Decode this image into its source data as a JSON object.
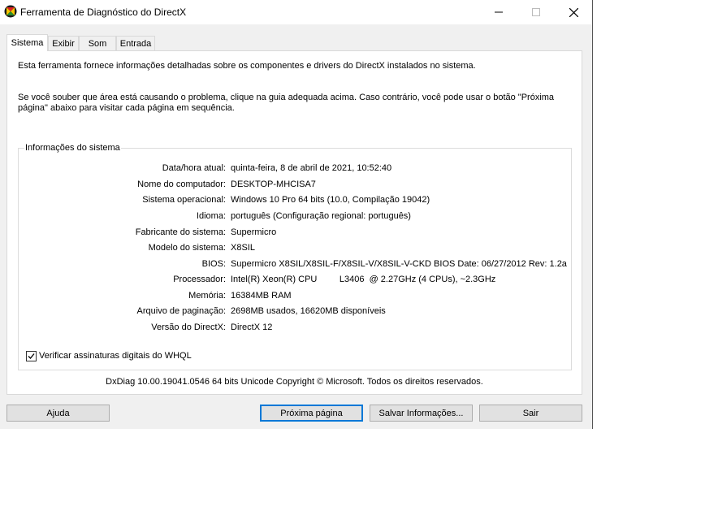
{
  "window": {
    "title": "Ferramenta de Diagnóstico do DirectX",
    "app_icon": "directx-icon"
  },
  "tabs": [
    {
      "label": "Sistema",
      "active": true
    },
    {
      "label": "Exibir",
      "active": false
    },
    {
      "label": "Som",
      "active": false
    },
    {
      "label": "Entrada",
      "active": false
    }
  ],
  "intro": {
    "line1": "Esta ferramenta fornece informações detalhadas sobre os componentes e drivers do DirectX instalados no sistema.",
    "line2": "Se você souber que área está causando o problema, clique na guia adequada acima. Caso contrário, você pode usar o botão \"Próxima página\" abaixo para visitar cada página em sequência."
  },
  "system_info": {
    "group_title": "Informações do sistema",
    "rows": [
      {
        "label": "Data/hora atual:",
        "value": "quinta-feira, 8 de abril de 2021, 10:52:40"
      },
      {
        "label": "Nome do computador:",
        "value": "DESKTOP-MHCISA7"
      },
      {
        "label": "Sistema operacional:",
        "value": "Windows 10 Pro 64 bits (10.0, Compilação 19042)"
      },
      {
        "label": "Idioma:",
        "value": "português (Configuração regional: português)"
      },
      {
        "label": "Fabricante do sistema:",
        "value": "Supermicro"
      },
      {
        "label": "Modelo do sistema:",
        "value": "X8SIL"
      },
      {
        "label": "BIOS:",
        "value": "Supermicro X8SIL/X8SIL-F/X8SIL-V/X8SIL-V-CKD BIOS Date: 06/27/2012 Rev: 1.2a"
      },
      {
        "label": "Processador:",
        "value": "Intel(R) Xeon(R) CPU         L3406  @ 2.27GHz (4 CPUs), ~2.3GHz"
      },
      {
        "label": "Memória:",
        "value": "16384MB RAM"
      },
      {
        "label": "Arquivo de paginação:",
        "value": "2698MB usados, 16620MB disponíveis"
      },
      {
        "label": "Versão do DirectX:",
        "value": "DirectX 12"
      }
    ],
    "whql_checkbox": {
      "label": "Verificar assinaturas digitais do WHQL",
      "checked": true
    }
  },
  "footer": {
    "copyright": "DxDiag 10.00.19041.0546 64 bits Unicode  Copyright © Microsoft. Todos os direitos reservados."
  },
  "buttons": {
    "help": "Ajuda",
    "next_page": "Próxima página",
    "save_info": "Salvar Informações...",
    "exit": "Sair"
  },
  "colors": {
    "accent": "#0078d7",
    "window_bg": "#f0f0f0",
    "panel_bg": "#ffffff"
  }
}
